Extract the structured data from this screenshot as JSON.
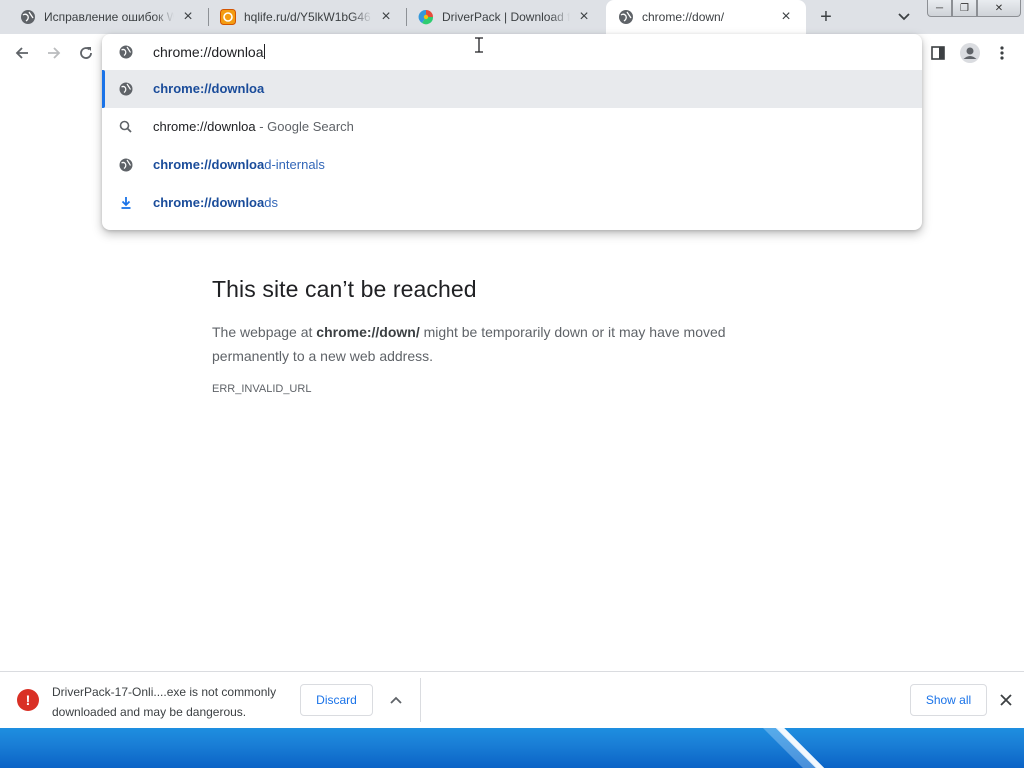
{
  "tabs": [
    {
      "title": "Исправление ошибок W",
      "icon": "chrome-globe-icon",
      "active": false
    },
    {
      "title": "hqlife.ru/d/Y5lkW1bG46",
      "icon": "hqlife-favicon",
      "active": false
    },
    {
      "title": "DriverPack | Download fr",
      "icon": "driverpack-favicon",
      "active": false
    },
    {
      "title": "chrome://down/",
      "icon": "globe-icon",
      "active": true
    }
  ],
  "window_controls": {
    "minimize": "─",
    "restore": "❐",
    "close": "✕"
  },
  "omnibox": {
    "input_value": "chrome://downloa",
    "suggestions": [
      {
        "bold": "chrome://downloa",
        "rest": "",
        "suffix": "",
        "icon": "globe-icon",
        "selected": true
      },
      {
        "bold": "",
        "rest": "",
        "plain": "chrome://downloa",
        "suffix": " - Google Search",
        "icon": "search-icon",
        "selected": false
      },
      {
        "bold": "chrome://downloa",
        "rest": "d-internals",
        "suffix": "",
        "icon": "globe-icon",
        "selected": false
      },
      {
        "bold": "chrome://downloa",
        "rest": "ds",
        "suffix": "",
        "icon": "download-icon",
        "selected": false
      }
    ]
  },
  "error_page": {
    "title": "This site can’t be reached",
    "body_prefix": "The webpage at ",
    "body_url": "chrome://down/",
    "body_suffix": " might be temporarily down or it may have moved permanently to a new web address.",
    "code": "ERR_INVALID_URL"
  },
  "download_bar": {
    "line1": "DriverPack-17-Onli....exe is not commonly",
    "line2": "downloaded and may be dangerous.",
    "discard_label": "Discard",
    "show_all_label": "Show all"
  },
  "colors": {
    "accent": "#1a73e8",
    "warning": "#d93025",
    "tabstrip": "#dee1e6",
    "taskbar": "#1a7fd6"
  }
}
